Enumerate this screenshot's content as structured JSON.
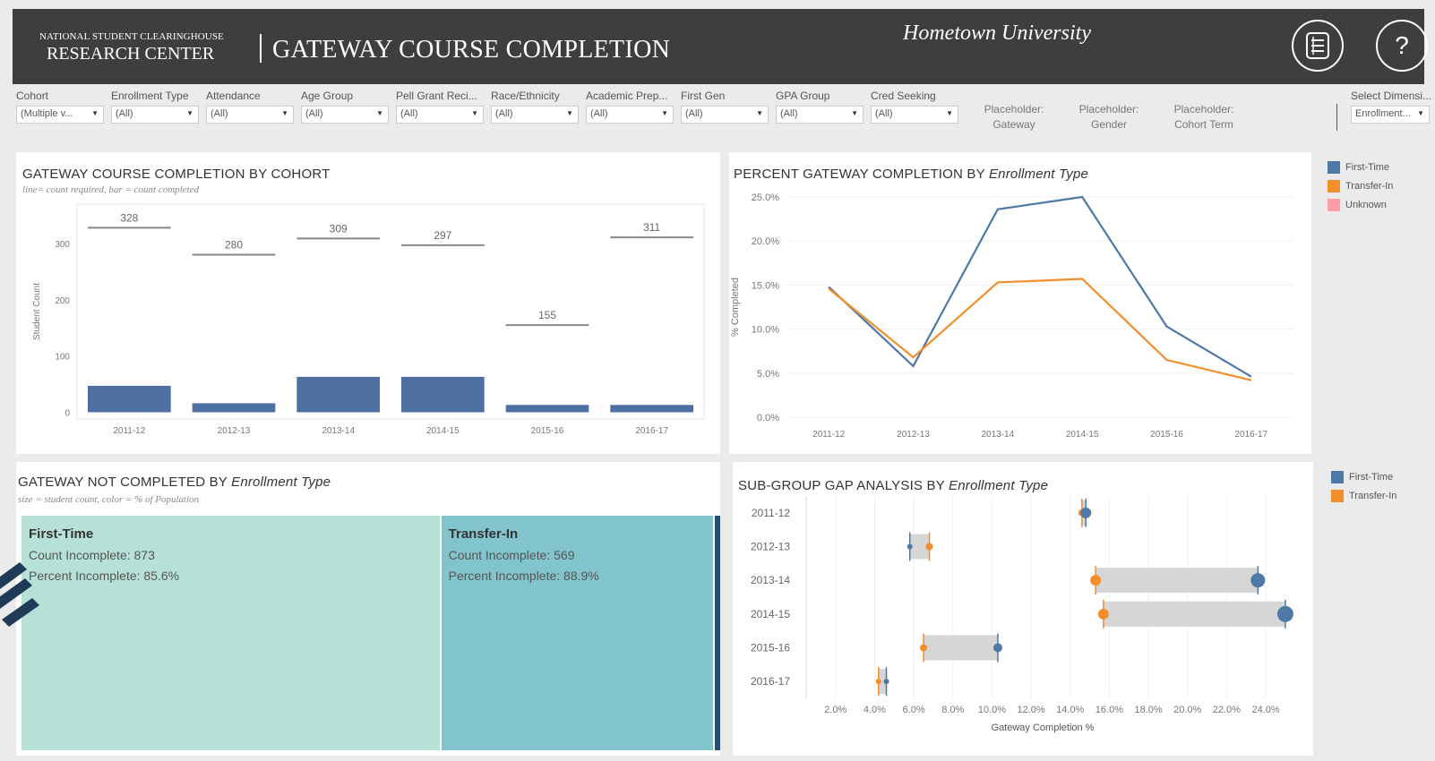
{
  "header": {
    "org_top": "NATIONAL STUDENT CLEARINGHOUSE",
    "org_bottom": "RESEARCH CENTER",
    "title": "GATEWAY COURSE COMPLETION",
    "university": "Hometown University",
    "help_glyph": "?"
  },
  "filters": [
    {
      "label": "Cohort",
      "value": "(Multiple v..."
    },
    {
      "label": "Enrollment Type",
      "value": "(All)"
    },
    {
      "label": "Attendance",
      "value": "(All)"
    },
    {
      "label": "Age Group",
      "value": "(All)"
    },
    {
      "label": "Pell Grant Reci...",
      "value": "(All)"
    },
    {
      "label": "Race/Ethnicity",
      "value": "(All)"
    },
    {
      "label": "Academic Prep...",
      "value": "(All)"
    },
    {
      "label": "First Gen",
      "value": "(All)"
    },
    {
      "label": "GPA Group",
      "value": "(All)"
    },
    {
      "label": "Cred Seeking",
      "value": "(All)"
    }
  ],
  "placeholders": [
    {
      "line1": "Placeholder:",
      "line2": "Gateway"
    },
    {
      "line1": "Placeholder:",
      "line2": "Gender"
    },
    {
      "line1": "Placeholder:",
      "line2": "Cohort Term"
    }
  ],
  "select_dimension": {
    "label": "Select Dimensi...",
    "value": "Enrollment..."
  },
  "caret": "▼",
  "panels": {
    "cohort": {
      "title": "GATEWAY COURSE COMPLETION BY COHORT",
      "subtitle": "line= count required, bar = count completed"
    },
    "percent": {
      "title_plain": "PERCENT GATEWAY COMPLETION BY ",
      "title_italic": "Enrollment Type"
    },
    "not_completed": {
      "title_plain": "GATEWAY NOT COMPLETED BY ",
      "title_italic": "Enrollment Type",
      "subtitle": "size = student count, color = % of Population"
    },
    "gap": {
      "title_plain": "SUB-GROUP GAP ANALYSIS BY ",
      "title_italic": "Enrollment Type"
    }
  },
  "legend_top": [
    {
      "name": "First-Time",
      "color": "#4e79a7"
    },
    {
      "name": "Transfer-In",
      "color": "#f28e2b"
    },
    {
      "name": "Unknown",
      "color": "#ff9da7"
    }
  ],
  "legend_bottom": [
    {
      "name": "First-Time",
      "color": "#4e79a7"
    },
    {
      "name": "Transfer-In",
      "color": "#f28e2b"
    }
  ],
  "chart_data": [
    {
      "type": "bar",
      "title": "GATEWAY COURSE COMPLETION BY COHORT",
      "ylabel": "Student Count",
      "ylim": [
        -12,
        370
      ],
      "yticks": [
        0,
        100,
        200,
        300
      ],
      "categories": [
        "2011-12",
        "2012-13",
        "2013-14",
        "2014-15",
        "2015-16",
        "2016-17"
      ],
      "series": [
        {
          "name": "count completed",
          "values": [
            47,
            16,
            63,
            63,
            13,
            13
          ]
        },
        {
          "name": "count required",
          "values": [
            328,
            280,
            309,
            297,
            155,
            311
          ]
        }
      ],
      "required_labels": [
        "328",
        "280",
        "309",
        "297",
        "155",
        "311"
      ]
    },
    {
      "type": "line",
      "title": "PERCENT GATEWAY COMPLETION BY Enrollment Type",
      "ylabel": "% Completed",
      "ylim": [
        0,
        25
      ],
      "yticks": [
        "0.0%",
        "5.0%",
        "10.0%",
        "15.0%",
        "20.0%",
        "25.0%"
      ],
      "categories": [
        "2011-12",
        "2012-13",
        "2013-14",
        "2014-15",
        "2015-16",
        "2016-17"
      ],
      "series": [
        {
          "name": "First-Time",
          "color": "#4e79a7",
          "values": [
            14.8,
            5.8,
            23.6,
            25.0,
            10.3,
            4.6
          ]
        },
        {
          "name": "Transfer-In",
          "color": "#f28e2b",
          "values": [
            14.6,
            6.8,
            15.3,
            15.7,
            6.5,
            4.2
          ]
        }
      ]
    },
    {
      "type": "treemap",
      "title": "GATEWAY NOT COMPLETED BY Enrollment Type",
      "items": [
        {
          "name": "First-Time",
          "count_line": "Count Incomplete: 873",
          "pct_line": "Percent Incomplete: 85.6%",
          "count": 873,
          "color": "#b7e1d6"
        },
        {
          "name": "Transfer-In",
          "count_line": "Count Incomplete: 569",
          "pct_line": "Percent Incomplete: 88.9%",
          "count": 569,
          "color": "#82c4cc"
        },
        {
          "name": "",
          "count": 11,
          "color": "#1f4e79"
        }
      ]
    },
    {
      "type": "scatter",
      "title": "SUB-GROUP GAP ANALYSIS BY Enrollment Type",
      "xlabel": "Gateway Completion %",
      "xlim": [
        0.5,
        25.6
      ],
      "xticks": [
        "2.0%",
        "4.0%",
        "6.0%",
        "8.0%",
        "10.0%",
        "12.0%",
        "14.0%",
        "16.0%",
        "18.0%",
        "20.0%",
        "22.0%",
        "24.0%"
      ],
      "categories": [
        "2011-12",
        "2012-13",
        "2013-14",
        "2014-15",
        "2015-16",
        "2016-17"
      ],
      "series": [
        {
          "name": "First-Time",
          "color": "#4e79a7",
          "values": [
            14.8,
            5.8,
            23.6,
            25.0,
            10.3,
            4.6
          ]
        },
        {
          "name": "Transfer-In",
          "color": "#f28e2b",
          "values": [
            14.6,
            6.8,
            15.3,
            15.7,
            6.5,
            4.2
          ]
        }
      ],
      "sizes": [
        [
          6,
          4
        ],
        [
          3,
          4
        ],
        [
          8,
          6
        ],
        [
          9,
          6
        ],
        [
          5,
          4
        ],
        [
          3,
          3
        ]
      ]
    }
  ]
}
